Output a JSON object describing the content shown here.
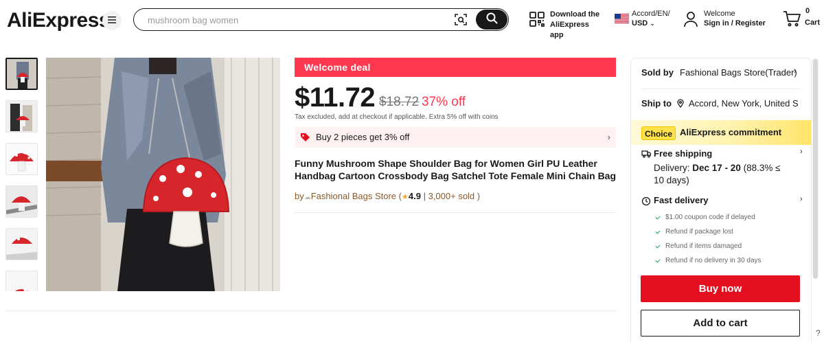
{
  "header": {
    "logo": "AliExpress",
    "search_placeholder": "mushroom bag women",
    "app_download_line1": "Download the",
    "app_download_line2": "AliExpress app",
    "lang_line1": "Accord/EN/",
    "lang_line2": "USD",
    "account_line1": "Welcome",
    "account_line2": "Sign in / Register",
    "cart_count": "0",
    "cart_label": "Cart"
  },
  "gallery": {
    "thumbnail_count": 6
  },
  "product": {
    "deal_label": "Welcome deal",
    "price": "$11.72",
    "old_price": "$18.72",
    "discount": "37% off",
    "tax_note": "Tax excluded, add at checkout if applicable. Extra 5% off with coins",
    "promo_text": "Buy 2 pieces get 3% off",
    "title": "Funny Mushroom Shape Shoulder Bag for Women Girl PU Leather Handbag Cartoon Crossbody Bag Satchel Tote Female Mini Chain Bag",
    "by_label": "by",
    "store_name": "Fashional Bags Store",
    "rating": "4.9",
    "sold": "3,000+ sold"
  },
  "panel": {
    "sold_by_label": "Sold by",
    "sold_by_value": "Fashional Bags Store(Trader)",
    "ship_to_label": "Ship to",
    "ship_to_value": "Accord, New York, United S",
    "choice_badge": "Choice",
    "commitment": "AliExpress commitment",
    "free_shipping": "Free shipping",
    "delivery_prefix": "Delivery:",
    "delivery_dates": "Dec 17 - 20",
    "delivery_suffix": "(88.3% ≤ 10 days)",
    "fast_delivery": "Fast delivery",
    "guarantees": [
      "$1.00 coupon code if delayed",
      "Refund if package lost",
      "Refund if items damaged",
      "Refund if no delivery in 30 days"
    ],
    "buy_now": "Buy now",
    "add_to_cart": "Add to cart"
  },
  "colors": {
    "brand_red": "#e4101f",
    "deal_red": "#fd384f",
    "choice_yellow": "#ffe14a"
  }
}
